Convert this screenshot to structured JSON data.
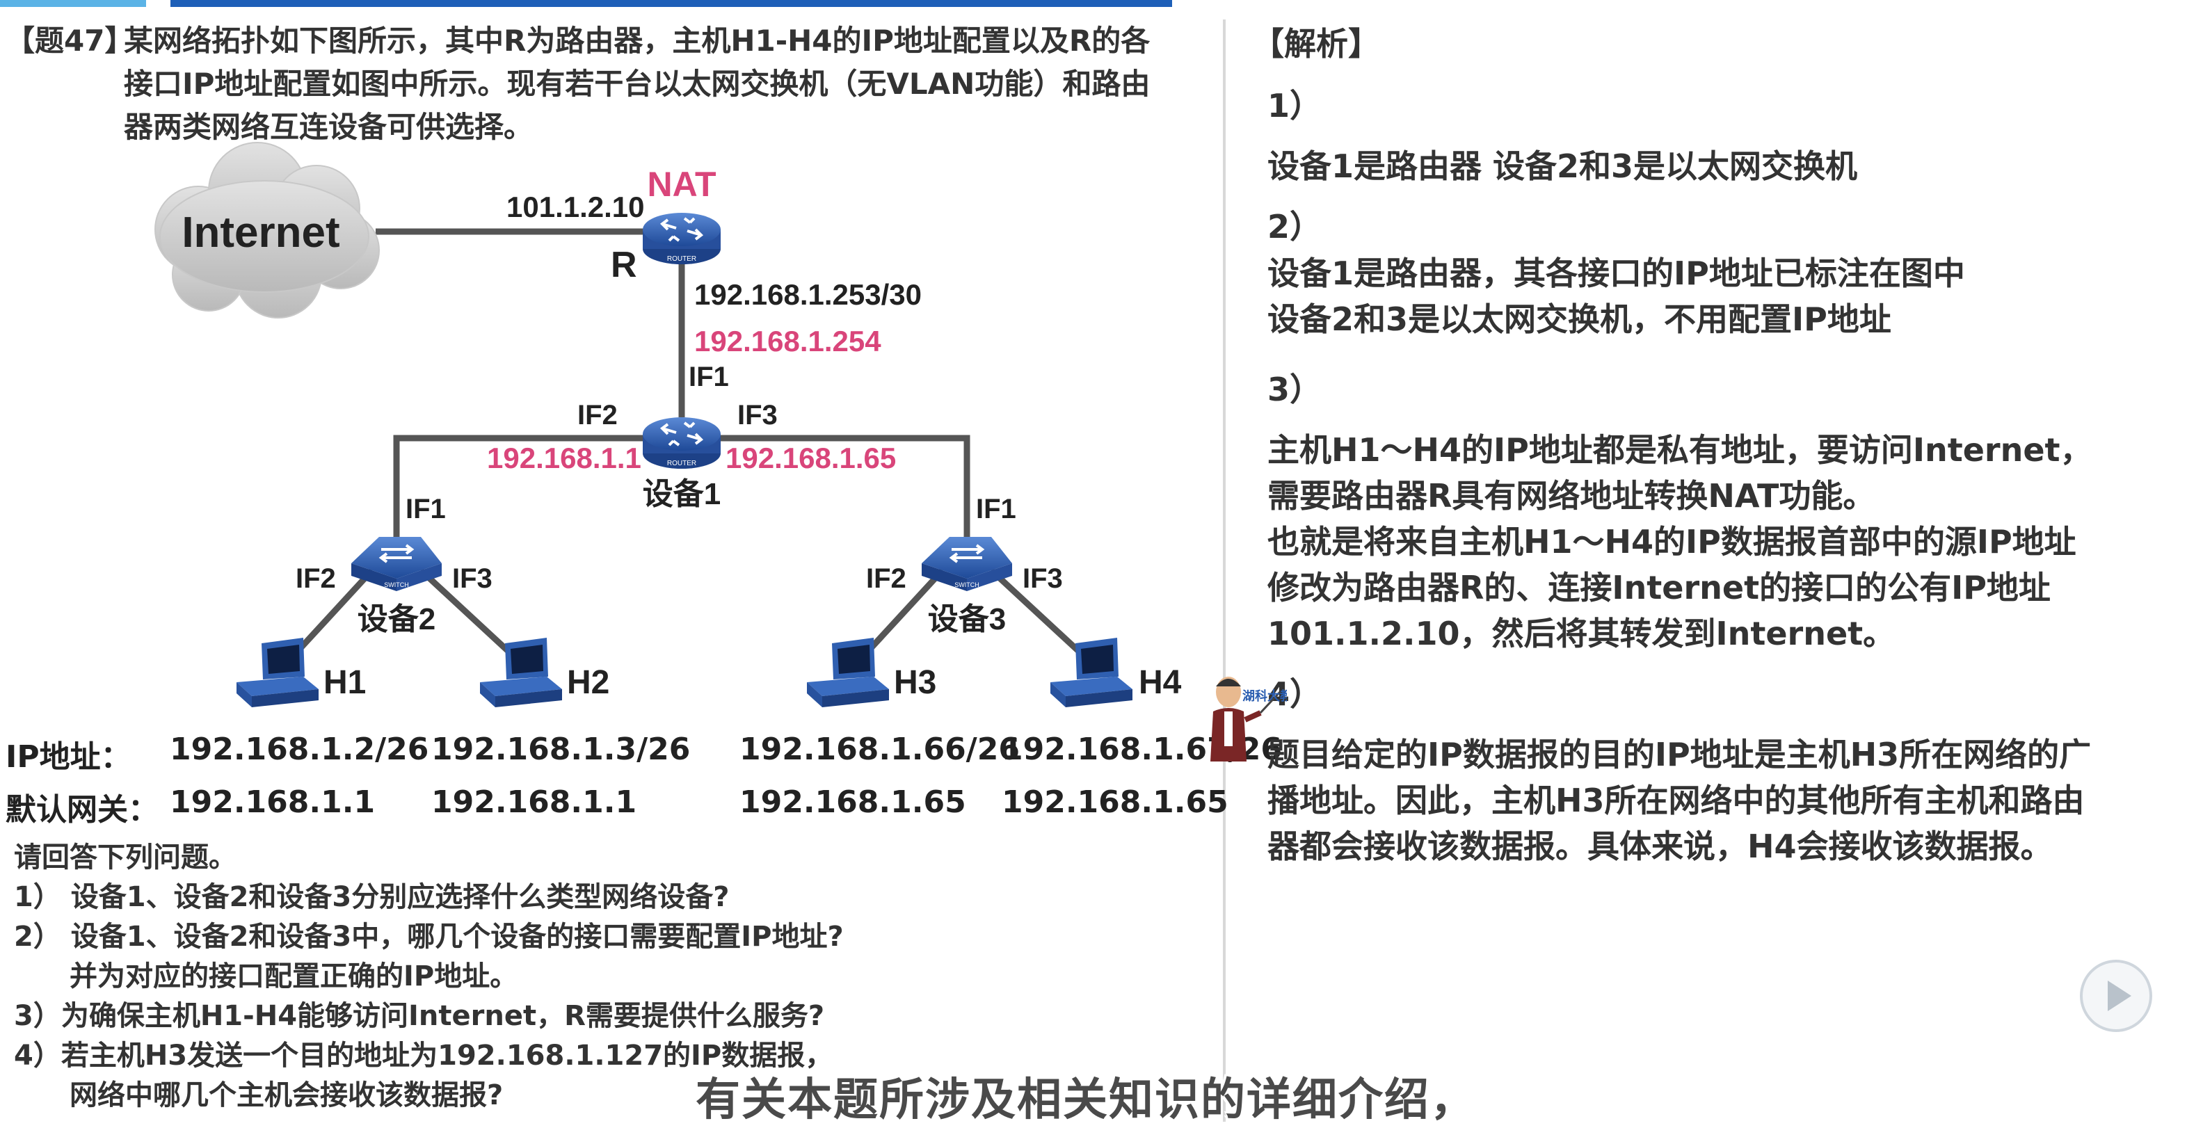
{
  "question": {
    "tag": "【题47】",
    "lines": [
      "某网络拓扑如下图所示，其中R为路由器，主机H1-H4的IP地址配置以及R的各",
      "接口IP地址配置如图中所示。现有若干台以太网交换机（无VLAN功能）和路由",
      "器两类网络互连设备可供选择。"
    ]
  },
  "diagram": {
    "cloud_label": "Internet",
    "nat_label": "NAT",
    "r_label": "R",
    "r_wan_ip": "101.1.2.10",
    "r_lan_ip": "192.168.1.253/30",
    "dev1_if1_ip": "192.168.1.254",
    "if1": "IF1",
    "if2": "IF2",
    "if3": "IF3",
    "dev1_if2_ip": "192.168.1.1",
    "dev1_if3_ip": "192.168.1.65",
    "dev1_label": "设备1",
    "dev2_label": "设备2",
    "dev3_label": "设备3",
    "router_tag": "ROUTER",
    "switch_tag": "SWITCH",
    "hosts": [
      "H1",
      "H2",
      "H3",
      "H4"
    ],
    "colors": {
      "pink": "#d9457a",
      "device_blue": "#2f5fb0",
      "line": "#555555"
    }
  },
  "ip_table": {
    "ip_label": "IP地址：",
    "gw_label": "默认网关：",
    "ips": [
      "192.168.1.2/26",
      "192.168.1.3/26",
      "192.168.1.66/26",
      "192.168.1.67/26"
    ],
    "gateways": [
      "192.168.1.1",
      "192.168.1.1",
      "192.168.1.65",
      "192.168.1.65"
    ]
  },
  "questions": {
    "intro": "请回答下列问题。",
    "items": [
      "1）  设备1、设备2和设备3分别应选择什么类型网络设备?",
      "2）  设备1、设备2和设备3中，哪几个设备的接口需要配置IP地址?",
      "并为对应的接口配置正确的IP地址。",
      "3）为确保主机H1-H4能够访问Internet，R需要提供什么服务?",
      "4）若主机H3发送一个目的地址为192.168.1.127的IP数据报，",
      "网络中哪几个主机会接收该数据报?"
    ]
  },
  "answer": {
    "title": "【解析】",
    "s1_num": "1）",
    "s1_line": "设备1是路由器      设备2和3是以太网交换机",
    "s2_num": "2）",
    "s2_lines": [
      "设备1是路由器，其各接口的IP地址已标注在图中",
      "设备2和3是以太网交换机，不用配置IP地址"
    ],
    "s3_num": "3）",
    "s3_lines": [
      "主机H1～H4的IP地址都是私有地址，要访问Internet，",
      "需要路由器R具有网络地址转换NAT功能。",
      "也就是将来自主机H1～H4的IP数据报首部中的源IP地址",
      "修改为路由器R的、连接Internet的接口的公有IP地址",
      "101.1.2.10，然后将其转发到Internet。"
    ],
    "s4_num": "4）",
    "s4_lines": [
      "题目给定的IP数据报的目的IP地址是主机H3所在网络的广",
      "播地址。因此，主机H3所在网络中的其他所有主机和路由",
      "器都会接收该数据报。具体来说，H4会接收该数据报。"
    ]
  },
  "avatar_sign": "湖科大教书匠",
  "subtitle": "有关本题所涉及相关知识的详细介绍，"
}
